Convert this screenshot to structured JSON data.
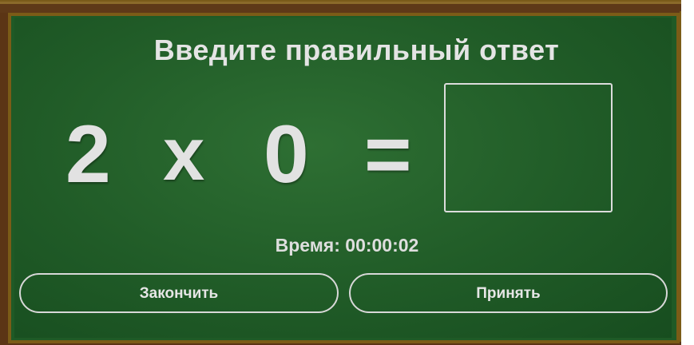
{
  "title": "Введите правильный ответ",
  "expression": {
    "operand_a": "2",
    "operator": "x",
    "operand_b": "0",
    "equals": "="
  },
  "answer": {
    "value": "",
    "placeholder": ""
  },
  "timer": {
    "text": "Время: 00:00:02"
  },
  "buttons": {
    "finish_label": "Закончить",
    "accept_label": "Принять"
  },
  "colors": {
    "board": "#205b27",
    "frame": "#5b3515",
    "rim": "#7b5c17",
    "chalk": "#e2e2e2"
  }
}
